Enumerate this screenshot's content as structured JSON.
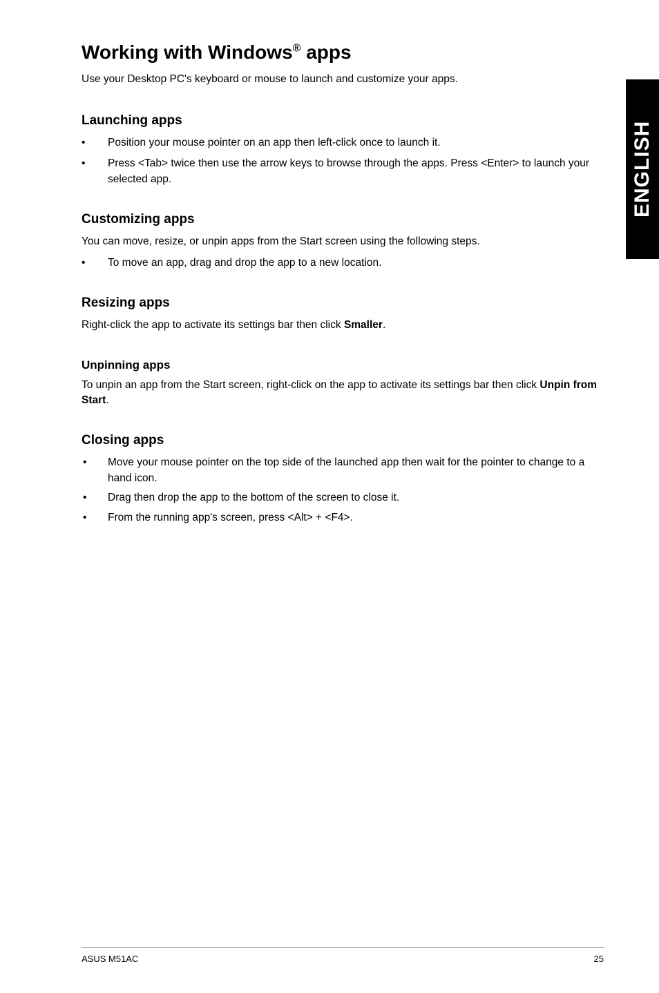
{
  "sideTab": "ENGLISH",
  "heading": {
    "pre": "Working with Windows",
    "sup": "®",
    "post": " apps"
  },
  "intro": "Use your Desktop PC's keyboard or mouse to launch and customize your apps.",
  "sections": {
    "launching": {
      "title": "Launching apps",
      "items": [
        "Position your mouse pointer on an app then left-click once to launch it.",
        "Press <Tab> twice then use the arrow keys to browse through the apps. Press <Enter> to launch your selected app."
      ]
    },
    "customizing": {
      "title": "Customizing apps",
      "body": "You can move, resize, or unpin apps from the Start screen using the following steps.",
      "items": [
        "To move an app, drag and drop the app to a new location."
      ]
    },
    "resizing": {
      "title": "Resizing apps",
      "body_pre": "Right-click the app to activate its settings bar then click ",
      "body_bold": "Smaller",
      "body_post": "."
    },
    "unpinning": {
      "title": "Unpinning apps",
      "body_pre": "To unpin an app from the Start screen, right-click on the app to activate its settings bar then click ",
      "body_bold": "Unpin from Start",
      "body_post": "."
    },
    "closing": {
      "title": "Closing apps",
      "items": [
        "Move your mouse pointer on the top side of the launched app then wait for the pointer to change to a hand icon.",
        "Drag then drop the app to the bottom of the screen to close it.",
        "From the running app's screen, press <Alt> + <F4>."
      ]
    }
  },
  "footer": {
    "left": "ASUS M51AC",
    "right": "25"
  }
}
